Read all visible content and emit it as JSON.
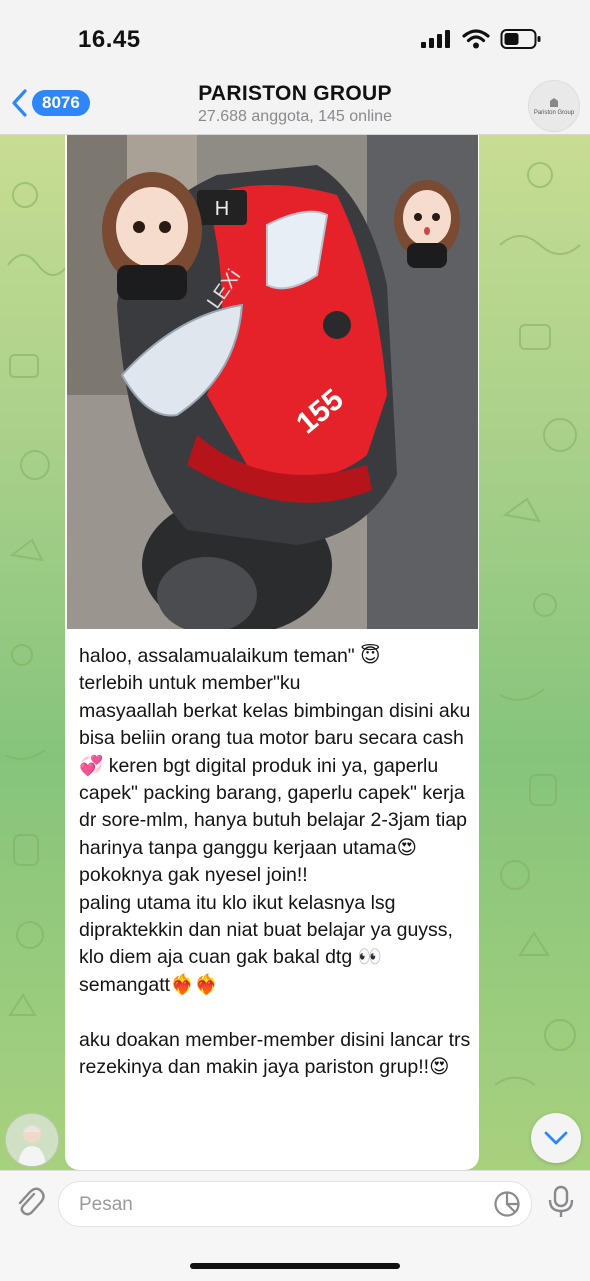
{
  "status_bar": {
    "time": "16.45",
    "icons": [
      "signal-icon",
      "wifi-icon",
      "battery-icon"
    ]
  },
  "header": {
    "back_count": "8076",
    "title": "PARISTON GROUP",
    "subtitle": "27.688 anggota, 145 online",
    "avatar_text": "Pariston Group"
  },
  "message": {
    "image": {
      "plate_text": "H",
      "model_text": "LEXi",
      "engine_text": "155"
    },
    "text": "haloo, assalamualaikum teman\" 😇\nterlebih untuk member\"ku\nmasyaallah berkat kelas bimbingan disini aku bisa beliin orang tua motor baru secara cash💞 keren bgt digital produk ini ya, gaperlu capek\" packing barang, gaperlu capek\" kerja dr sore-mlm, hanya butuh belajar 2-3jam tiap harinya tanpa ganggu kerjaan utama😍 pokoknya gak nyesel join!!\npaling utama itu klo ikut kelasnya lsg dipraktekkin dan niat buat belajar ya guyss, klo diem aja cuan gak bakal dtg 👀\nsemangatt❤️‍🔥❤️‍🔥\n\naku doakan member-member disini lancar trs rezekinya dan makin jaya pariston grup!!😍"
  },
  "input": {
    "placeholder": "Pesan"
  },
  "colors": {
    "accent": "#2f86f6",
    "bike_red": "#e5222a",
    "chat_bg": "#a9d08a"
  }
}
